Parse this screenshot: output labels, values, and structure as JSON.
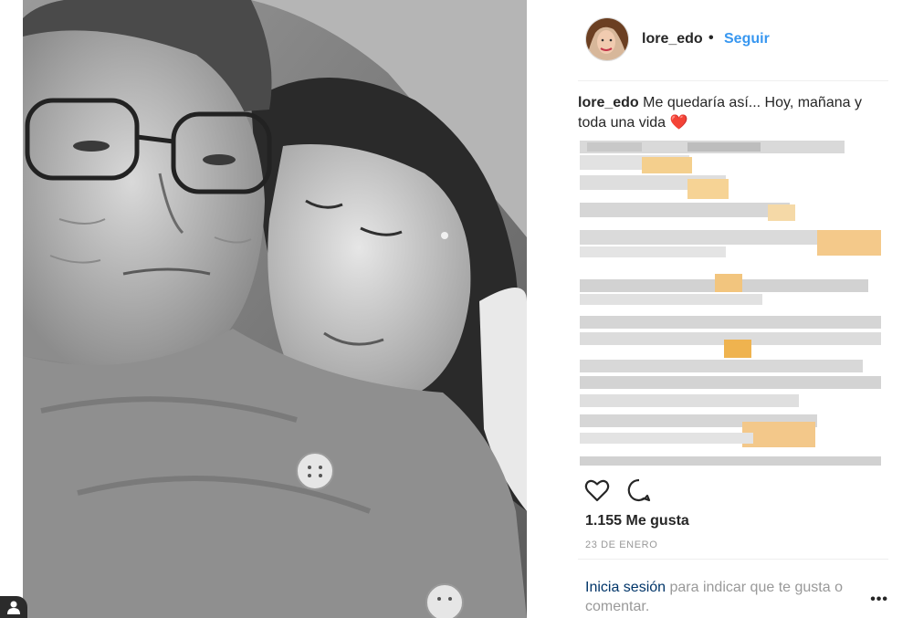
{
  "post": {
    "username": "lore_edo",
    "separator": "•",
    "follow_label": "Seguir",
    "caption_user": "lore_edo",
    "caption_text": "Me quedaría así... Hoy, mañana y toda una vida",
    "caption_emoji": "❤️",
    "likes": "1.155 Me gusta",
    "date": "23 DE ENERO",
    "login_link": "Inicia sesión",
    "login_text": "para indicar que te gusta o comentar.",
    "more_label": "•••"
  },
  "icons": {
    "like": "heart-icon",
    "comment": "comment-icon",
    "person": "person-icon"
  },
  "colors": {
    "accent": "#3897f0",
    "link": "#003569",
    "muted": "#999999",
    "text": "#262626"
  }
}
